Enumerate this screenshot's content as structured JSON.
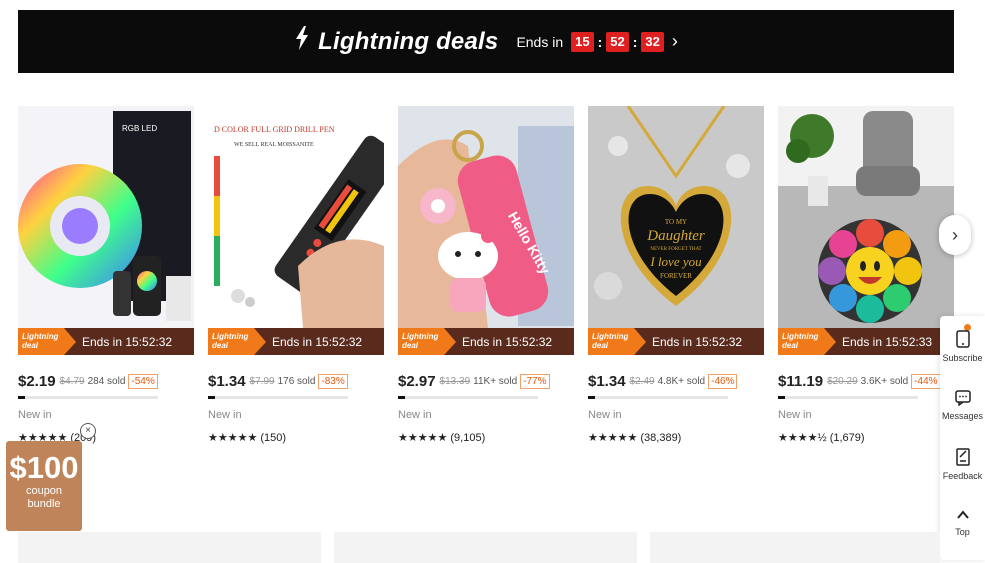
{
  "banner": {
    "title": "Lightning deals",
    "ends_label": "Ends in",
    "hours": "15",
    "minutes": "52",
    "seconds": "32",
    "colon": ":"
  },
  "badge_label": "Lightning deal",
  "products": [
    {
      "ends": "Ends in 15:52:32",
      "price": "$2.19",
      "old_price": "$4.79",
      "sold": "284 sold",
      "discount": "-54%",
      "progress": 0.05,
      "tag": "New in",
      "stars": "★★★★★",
      "reviews": "(209)"
    },
    {
      "ends": "Ends in 15:52:32",
      "price": "$1.34",
      "old_price": "$7.99",
      "sold": "176 sold",
      "discount": "-83%",
      "progress": 0.05,
      "tag": "New in",
      "stars": "★★★★★",
      "reviews": "(150)"
    },
    {
      "ends": "Ends in 15:52:32",
      "price": "$2.97",
      "old_price": "$13.39",
      "sold": "11K+ sold",
      "discount": "-77%",
      "progress": 0.05,
      "tag": "New in",
      "stars": "★★★★★",
      "reviews": "(9,105)"
    },
    {
      "ends": "Ends in 15:52:32",
      "price": "$1.34",
      "old_price": "$2.49",
      "sold": "4.8K+ sold",
      "discount": "-46%",
      "progress": 0.05,
      "tag": "New in",
      "stars": "★★★★★",
      "reviews": "(38,389)"
    },
    {
      "ends": "Ends in 15:52:33",
      "price": "$11.19",
      "old_price": "$20.29",
      "sold": "3.6K+ sold",
      "discount": "-44%",
      "progress": 0.05,
      "tag": "New in",
      "stars": "★★★★½",
      "reviews": "(1,679)"
    }
  ],
  "image_text": {
    "led_box": "RGB LED",
    "pen_title": "D COLOR FULL GRID DRILL PEN",
    "pen_sub": "WE SELL REAL MOISSANITE",
    "keychain": "Hello Kitty",
    "necklace_1": "TO MY",
    "necklace_2": "Daughter",
    "necklace_3": "NEVER FORGET THAT",
    "necklace_4": "I love you",
    "necklace_5": "FOREVER"
  },
  "side": {
    "subscribe": "Subscribe",
    "messages": "Messages",
    "feedback": "Feedback",
    "top": "Top"
  },
  "coupon": {
    "amount": "$100",
    "label1": "coupon",
    "label2": "bundle",
    "close": "×"
  },
  "colors": {
    "banner_bg": "#0b0b0b",
    "timer_red": "#e02020",
    "badge_orange": "#f07a1a",
    "badge_brown": "#5a2b1c",
    "discount_orange": "#e8580c",
    "coupon_bg": "#c0845a"
  },
  "icons": {
    "bolt": "⚡",
    "chevron_right": "›",
    "subscribe": "📱",
    "messages": "💬",
    "feedback": "📝",
    "top": "^"
  }
}
